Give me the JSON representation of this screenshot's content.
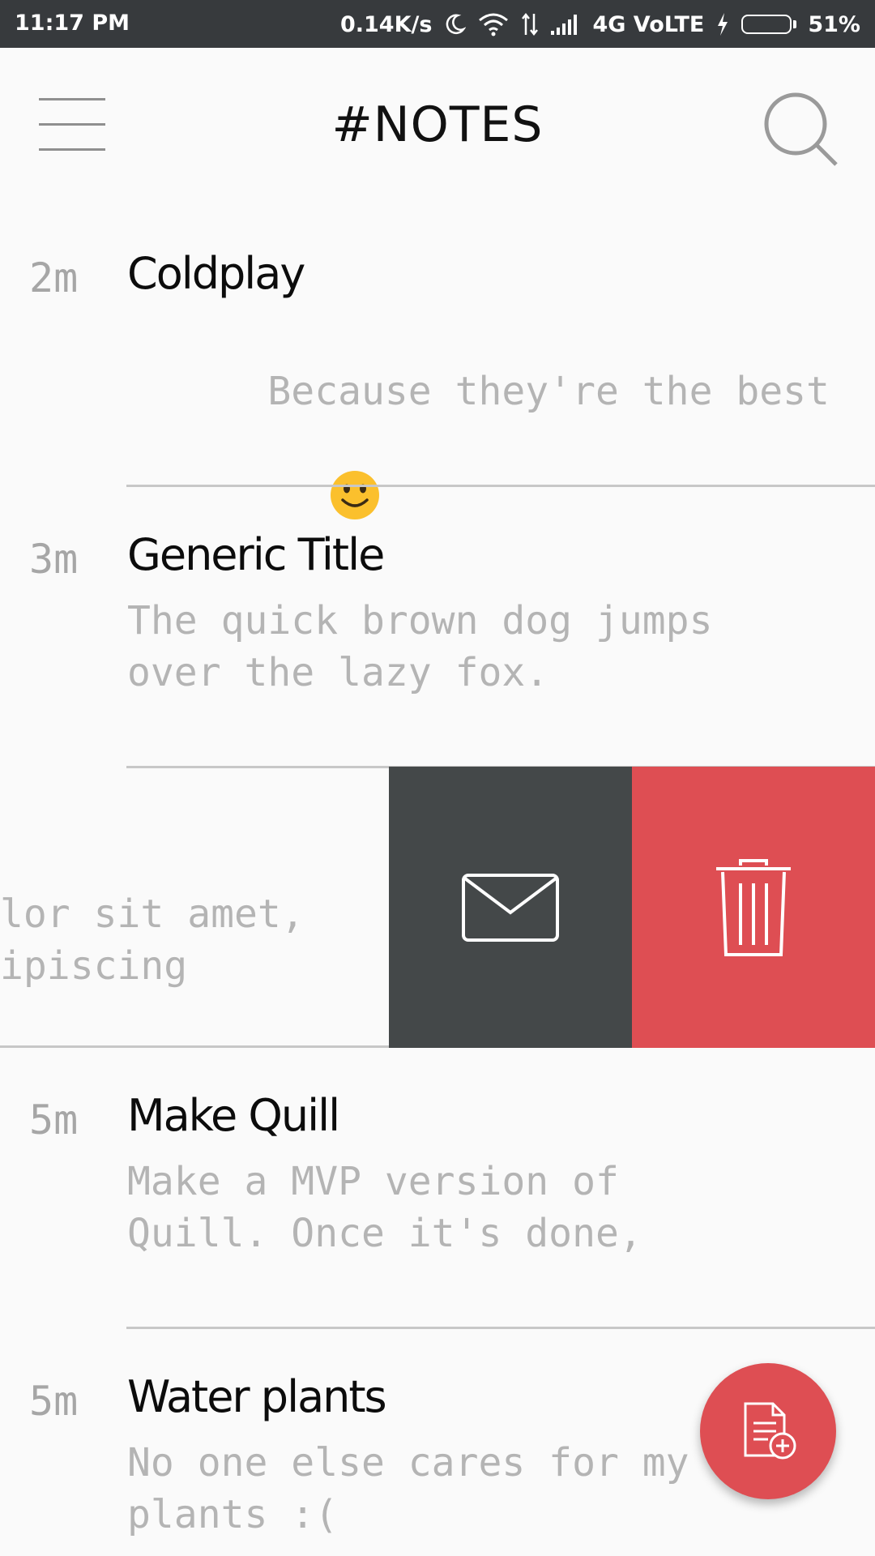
{
  "status_bar": {
    "time": "11:17 PM",
    "net_speed": "0.14K/s",
    "network": "4G VoLTE",
    "battery": "51%",
    "battery_level": 0.51,
    "icons": [
      "moon-icon",
      "wifi-icon",
      "data-arrows-icon",
      "signal-icon",
      "charging-icon",
      "battery-icon"
    ]
  },
  "toolbar": {
    "title": "#NOTES",
    "menu_icon": "hamburger-menu-icon",
    "search_icon": "search-icon"
  },
  "notes": [
    {
      "time": "2m",
      "title": "Coldplay",
      "body": "Because they're the best",
      "emoji": "smile-icon"
    },
    {
      "time": "3m",
      "title": "Generic Title",
      "body": "The quick brown dog jumps\nover the lazy fox."
    },
    {
      "time": "5m",
      "title": "Make Quill",
      "body": "Make a MVP version of\nQuill. Once it's done,"
    },
    {
      "time": "5m",
      "title": "Water plants",
      "body": "No one else cares for my\nplants :("
    }
  ],
  "swiped_note": {
    "visible_text": "lor sit amet,\nipiscing",
    "actions": [
      {
        "name": "email",
        "icon": "envelope-icon",
        "color": "#444849"
      },
      {
        "name": "delete",
        "icon": "trash-icon",
        "color": "#de4e53"
      }
    ]
  },
  "fab": {
    "icon": "new-note-icon",
    "color": "#de4e53"
  }
}
